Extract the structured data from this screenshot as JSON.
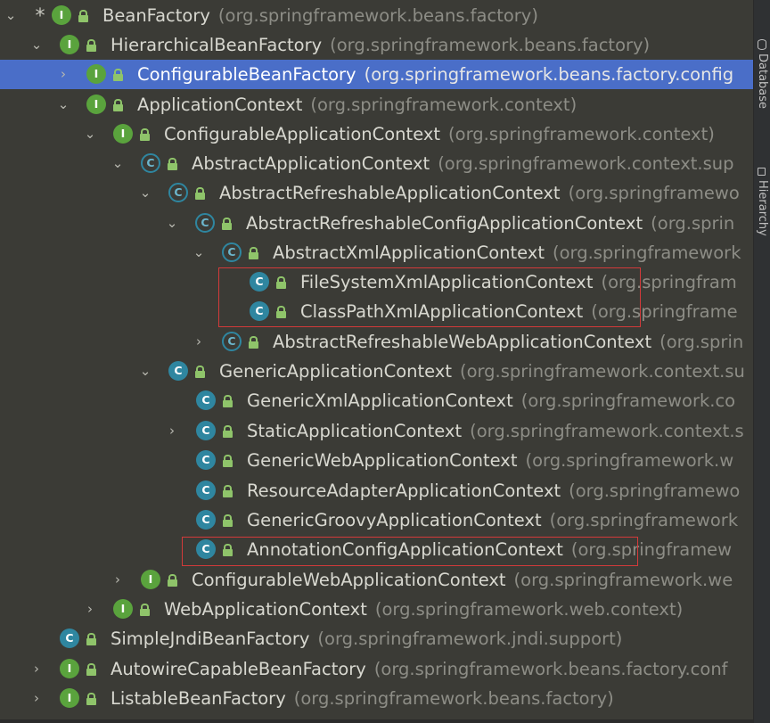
{
  "tree": {
    "rows": [
      {
        "name": "BeanFactory",
        "package": "(org.springframework.beans.factory)",
        "kind": "interface",
        "arrow": "down",
        "star": "*"
      },
      {
        "name": "HierarchicalBeanFactory",
        "package": "(org.springframework.beans.factory)",
        "kind": "interface",
        "arrow": "down"
      },
      {
        "name": "ConfigurableBeanFactory",
        "package": "(org.springframework.beans.factory.config",
        "kind": "interface",
        "arrow": "right",
        "selected": true
      },
      {
        "name": "ApplicationContext",
        "package": "(org.springframework.context)",
        "kind": "interface",
        "arrow": "down"
      },
      {
        "name": "ConfigurableApplicationContext",
        "package": "(org.springframework.context)",
        "kind": "interface",
        "arrow": "down"
      },
      {
        "name": "AbstractApplicationContext",
        "package": "(org.springframework.context.sup",
        "kind": "abstract-class",
        "arrow": "down"
      },
      {
        "name": "AbstractRefreshableApplicationContext",
        "package": "(org.springframewo",
        "kind": "abstract-class",
        "arrow": "down"
      },
      {
        "name": "AbstractRefreshableConfigApplicationContext",
        "package": "(org.sprin",
        "kind": "abstract-class",
        "arrow": "down"
      },
      {
        "name": "AbstractXmlApplicationContext",
        "package": "(org.springframework",
        "kind": "abstract-class",
        "arrow": "down"
      },
      {
        "name": "FileSystemXmlApplicationContext",
        "package": "(org.springfram",
        "kind": "class"
      },
      {
        "name": "ClassPathXmlApplicationContext",
        "package": "(org.springframe",
        "kind": "class"
      },
      {
        "name": "AbstractRefreshableWebApplicationContext",
        "package": "(org.sprin",
        "kind": "abstract-class",
        "arrow": "right"
      },
      {
        "name": "GenericApplicationContext",
        "package": "(org.springframework.context.su",
        "kind": "class",
        "arrow": "down"
      },
      {
        "name": "GenericXmlApplicationContext",
        "package": "(org.springframework.co",
        "kind": "class"
      },
      {
        "name": "StaticApplicationContext",
        "package": "(org.springframework.context.s",
        "kind": "class",
        "arrow": "right"
      },
      {
        "name": "GenericWebApplicationContext",
        "package": "(org.springframework.w",
        "kind": "class"
      },
      {
        "name": "ResourceAdapterApplicationContext",
        "package": "(org.springframewo",
        "kind": "class"
      },
      {
        "name": "GenericGroovyApplicationContext",
        "package": "(org.springframework",
        "kind": "class"
      },
      {
        "name": "AnnotationConfigApplicationContext",
        "package": "(org.springframew",
        "kind": "class"
      },
      {
        "name": "ConfigurableWebApplicationContext",
        "package": "(org.springframework.we",
        "kind": "interface",
        "arrow": "right"
      },
      {
        "name": "WebApplicationContext",
        "package": "(org.springframework.web.context)",
        "kind": "interface",
        "arrow": "right"
      },
      {
        "name": "SimpleJndiBeanFactory",
        "package": "(org.springframework.jndi.support)",
        "kind": "class"
      },
      {
        "name": "AutowireCapableBeanFactory",
        "package": "(org.springframework.beans.factory.conf",
        "kind": "interface",
        "arrow": "right"
      },
      {
        "name": "ListableBeanFactory",
        "package": "(org.springframework.beans.factory)",
        "kind": "interface",
        "arrow": "right"
      }
    ]
  },
  "badges": {
    "interface": "I",
    "class": "C",
    "abstract-class": "C"
  },
  "colors": {
    "interface": "#5aa33d",
    "class": "#2f86a0",
    "selection": "#4a6ec8",
    "highlight": "#d23a3a"
  },
  "sidebar": {
    "tabs": [
      "Database",
      "Hierarchy"
    ]
  }
}
